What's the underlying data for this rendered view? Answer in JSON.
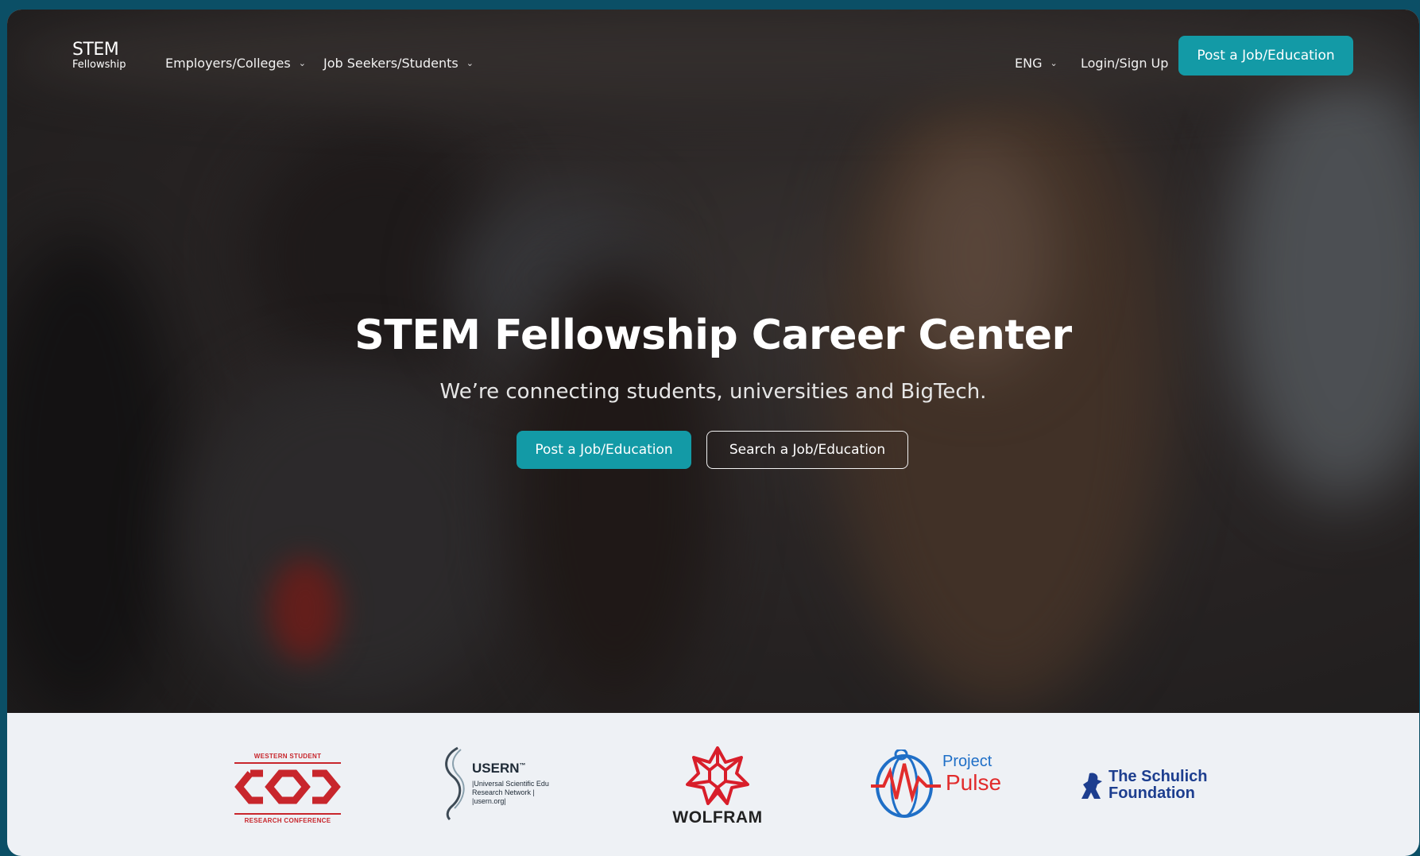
{
  "nav": {
    "logo": {
      "line1": "STEM",
      "line2": "Fellowship"
    },
    "employers": "Employers/Colleges",
    "jobseekers": "Job Seekers/Students",
    "language": "ENG",
    "login": "Login/Sign Up",
    "post_cta": "Post a Job/Education"
  },
  "hero": {
    "title": "STEM Fellowship Career Center",
    "subtitle": "We’re connecting students, universities and BigTech.",
    "primary_button": "Post a Job/Education",
    "secondary_button": "Search a Job/Education"
  },
  "partners": {
    "western": {
      "top": "WESTERN STUDENT",
      "bottom": "RESEARCH CONFERENCE"
    },
    "usern": {
      "name": "USERN",
      "tm": "™",
      "line1": "|Universal Scientific Edu",
      "line2": "Research Network |",
      "line3": "|usern.org|"
    },
    "wolfram": {
      "name": "WOLFRAM"
    },
    "pulse": {
      "line1": "Project",
      "line2": "Pulse"
    },
    "schulich": {
      "line1": "The Schulich",
      "line2": "Foundation"
    }
  },
  "colors": {
    "accent": "#139aa6",
    "page_background": "#0b4f66",
    "strip_background": "#eef1f5",
    "western_red": "#c8262c",
    "wolfram_red": "#d81e2a",
    "schulich_blue": "#1d3e8f"
  }
}
